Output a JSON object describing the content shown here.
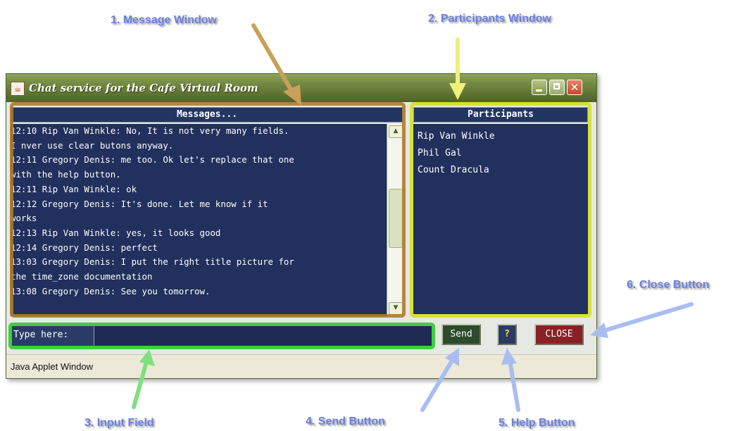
{
  "callouts": {
    "message_window": "1. Message Window",
    "participants_window": "2. Participants Window",
    "input_field": "3. Input Field",
    "send_button": "4. Send Button",
    "help_button": "5. Help Button",
    "close_button": "6. Close Button"
  },
  "window": {
    "title": "Chat service for the Cafe Virtual Room",
    "controls": [
      "minimize-icon",
      "maximize-icon",
      "close-icon"
    ]
  },
  "messages": {
    "header": "Messages...",
    "lines": [
      "12:10 Rip Van Winkle: No, It is not very many fields.",
      "I nver use clear butons anyway.",
      "12:11 Gregory Denis: me too. Ok let's replace that one",
      "with the help button.",
      "12:11 Rip Van Winkle: ok",
      "12:12 Gregory Denis: It's done. Let me know if it",
      "works",
      "12:13 Rip Van Winkle: yes, it looks good",
      "12:14 Gregory Denis: perfect",
      "13:03 Gregory Denis: I put the right title picture for",
      "the time_zone documentation",
      "13:08 Gregory Denis: See you tomorrow."
    ]
  },
  "participants": {
    "header": "Participants",
    "names": [
      "Rip Van Winkle",
      "Phil Gal",
      "Count Dracula"
    ]
  },
  "input": {
    "label": "Type here:",
    "value": ""
  },
  "buttons": {
    "send": "Send",
    "help": "?",
    "close": "CLOSE"
  },
  "status_bar": "Java Applet Window",
  "colors": {
    "pane_bg": "#21305c",
    "titlebar": "#6f8640",
    "highlight_messages": "#b07a2a",
    "highlight_participants": "#d8e03c",
    "highlight_input": "#3fcf3f",
    "callout_text": "#6a7fe0",
    "arrow_blue": "#a9bdf0"
  }
}
